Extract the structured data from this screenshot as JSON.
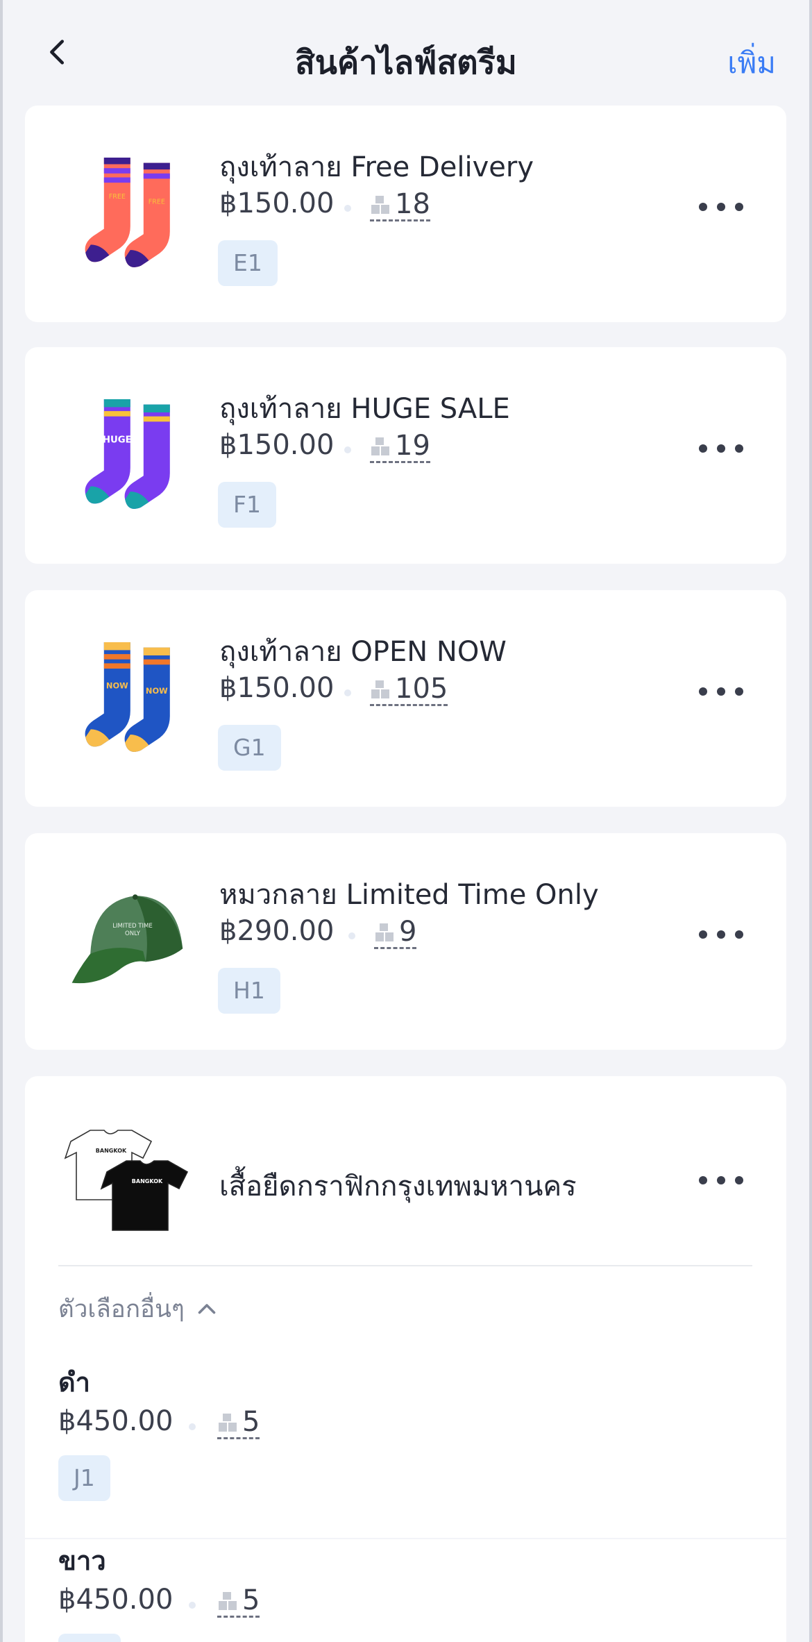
{
  "header": {
    "title": "สินค้าไลฟ์สตรีม",
    "add_label": "เพิ่ม",
    "back_icon": "chevron-left-icon"
  },
  "products": [
    {
      "name": "ถุงเท้าลาย Free Delivery",
      "price": "฿150.00",
      "stock": "18",
      "tag": "E1",
      "image": "socks-free-delivery-image",
      "colors": [
        "#ff6b5b",
        "#3d1f8f",
        "#7a3cf0"
      ]
    },
    {
      "name": "ถุงเท้าลาย HUGE SALE",
      "price": "฿150.00",
      "stock": "19",
      "tag": "F1",
      "image": "socks-huge-sale-image",
      "colors": [
        "#7a3cf0",
        "#f8c23a",
        "#19a3a8"
      ]
    },
    {
      "name": "ถุงเท้าลาย OPEN NOW",
      "price": "฿150.00",
      "stock": "105",
      "tag": "G1",
      "image": "socks-open-now-image",
      "colors": [
        "#1f55c4",
        "#f8bd4c",
        "#f0772a"
      ]
    },
    {
      "name": "หมวกลาย Limited Time Only",
      "price": "฿290.00",
      "stock": "9",
      "tag": "H1",
      "image": "green-cap-image",
      "colors": [
        "#2f6d32",
        "#4e7f57"
      ]
    }
  ],
  "shirt": {
    "name": "เสื้อยืดกราฟิกกรุงเทพมหานคร",
    "image": "tshirts-bangkok-image",
    "shirt_text": "BANGKOK",
    "options_label": "ตัวเลือกอื่นๆ",
    "options_icon": "chevron-up-icon",
    "variants": [
      {
        "name": "ดำ",
        "price": "฿450.00",
        "stock": "5",
        "tag": "J1"
      },
      {
        "name": "ขาว",
        "price": "฿450.00",
        "stock": "5",
        "tag": ""
      }
    ]
  },
  "colors": {
    "accent": "#3a7cf5",
    "tag_bg": "#e4effb",
    "background": "#f3f4f8"
  }
}
